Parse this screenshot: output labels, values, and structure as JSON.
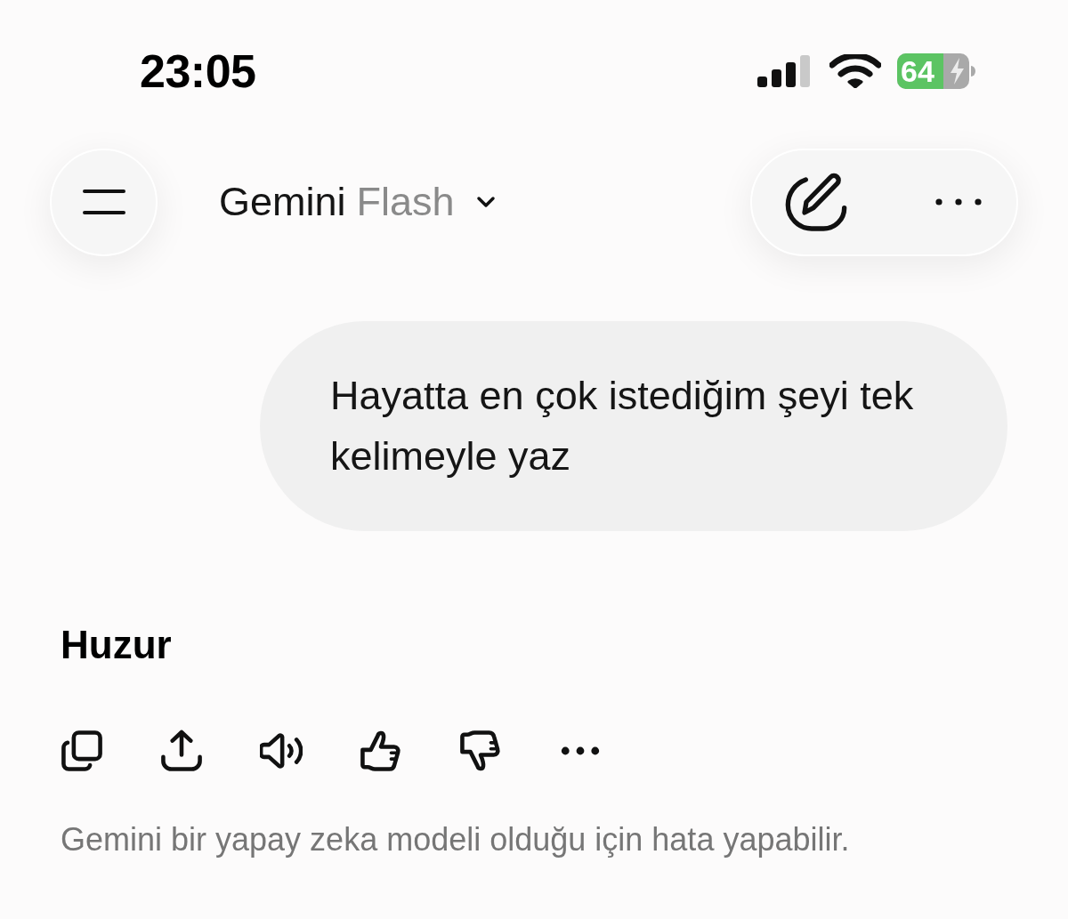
{
  "status_bar": {
    "time": "23:05",
    "battery_percent": "64"
  },
  "header": {
    "model_selector": {
      "name": "Gemini",
      "variant": "Flash"
    }
  },
  "messages": [
    {
      "kind": "user",
      "text": "Hayatta en çok istediğim şeyi tek kelimeyle yaz"
    },
    {
      "kind": "model",
      "text": "Huzur"
    }
  ],
  "disclaimer": "Gemini bir yapay zeka modeli olduğu için hata yapabilir."
}
